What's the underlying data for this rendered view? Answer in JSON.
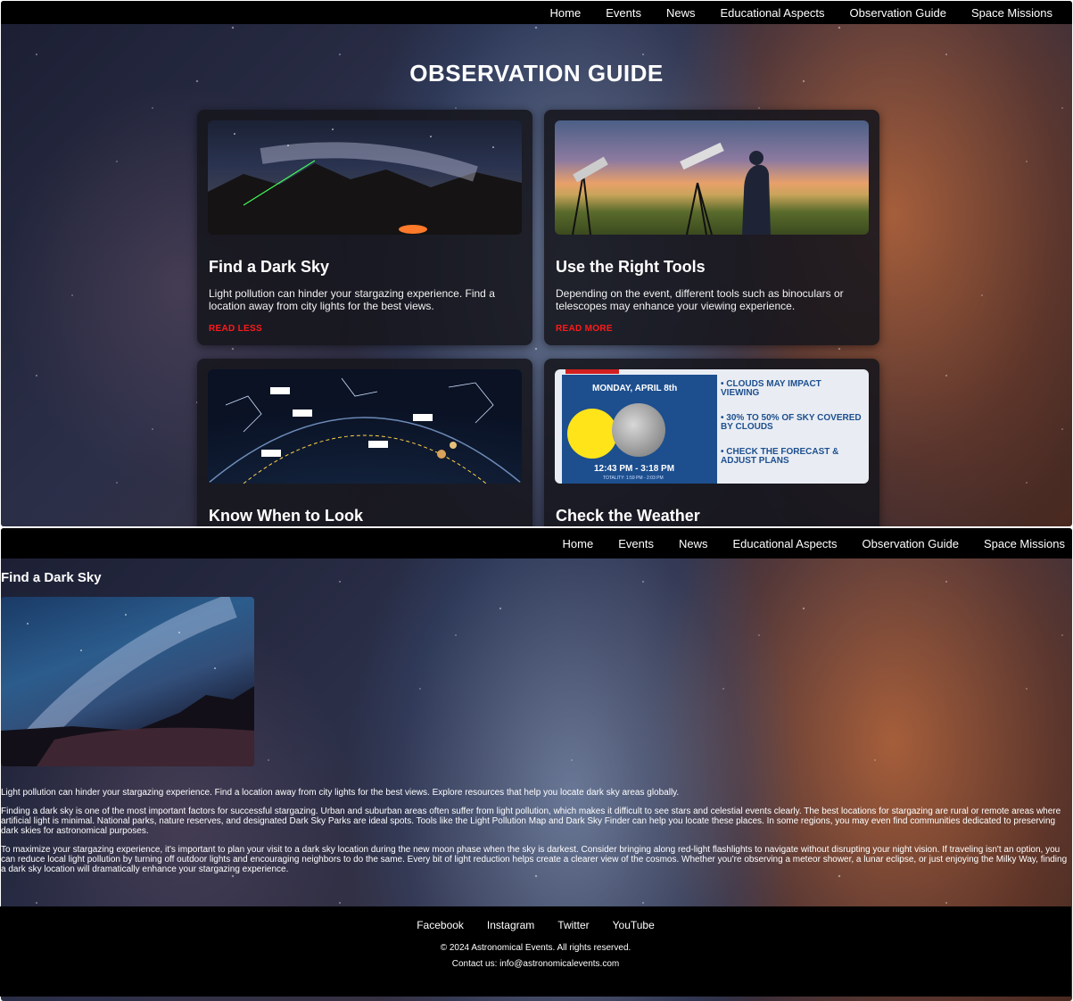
{
  "nav": {
    "items": [
      "Home",
      "Events",
      "News",
      "Educational Aspects",
      "Observation Guide",
      "Space Missions"
    ]
  },
  "guide": {
    "title": "OBSERVATION GUIDE",
    "cards": [
      {
        "title": "Find a Dark Sky",
        "text": "Light pollution can hinder your stargazing experience. Find a location away from city lights for the best views.",
        "toggle": "READ LESS"
      },
      {
        "title": "Use the Right Tools",
        "text": "Depending on the event, different tools such as binoculars or telescopes may enhance your viewing experience.",
        "toggle": "READ MORE"
      },
      {
        "title": "Know When to Look"
      },
      {
        "title": "Check the Weather",
        "weather": {
          "date": "MONDAY, APRIL 8th",
          "time": "12:43 PM - 3:18 PM",
          "totality": "TOTALITY: 1:59 PM - 2:03 PM",
          "bullets": [
            "CLOUDS MAY IMPACT VIEWING",
            "30% TO 50% OF SKY COVERED BY CLOUDS",
            "CHECK THE FORECAST & ADJUST PLANS"
          ]
        }
      }
    ]
  },
  "detail": {
    "title": "Find a Dark Sky",
    "paragraphs": [
      "Light pollution can hinder your stargazing experience. Find a location away from city lights for the best views. Explore resources that help you locate dark sky areas globally.",
      "Finding a dark sky is one of the most important factors for successful stargazing. Urban and suburban areas often suffer from light pollution, which makes it difficult to see stars and celestial events clearly. The best locations for stargazing are rural or remote areas where artificial light is minimal. National parks, nature reserves, and designated Dark Sky Parks are ideal spots. Tools like the Light Pollution Map and Dark Sky Finder can help you locate these places. In some regions, you may even find communities dedicated to preserving dark skies for astronomical purposes.",
      "To maximize your stargazing experience, it's important to plan your visit to a dark sky location during the new moon phase when the sky is darkest. Consider bringing along red-light flashlights to navigate without disrupting your night vision. If traveling isn't an option, you can reduce local light pollution by turning off outdoor lights and encouraging neighbors to do the same. Every bit of light reduction helps create a clearer view of the cosmos. Whether you're observing a meteor shower, a lunar eclipse, or just enjoying the Milky Way, finding a dark sky location will dramatically enhance your stargazing experience."
    ]
  },
  "footer": {
    "links": [
      "Facebook",
      "Instagram",
      "Twitter",
      "YouTube"
    ],
    "copyright": "© 2024 Astronomical Events. All rights reserved.",
    "contact": "Contact us: info@astronomicalevents.com"
  }
}
